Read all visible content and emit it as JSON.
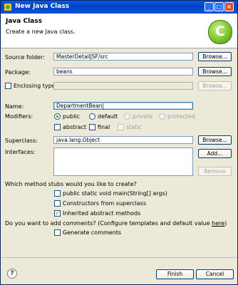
{
  "window": {
    "title": "New Java Class",
    "title_buttons": [
      "_",
      "□",
      "×"
    ]
  },
  "banner": {
    "title": "Java Class",
    "message": "Create a new Java class.",
    "logo_letter": "C"
  },
  "source_folder": {
    "label": "Source folder:",
    "value": "MasterDetailJSF/src",
    "browse": "Browse..."
  },
  "package": {
    "label": "Package:",
    "value": "beans",
    "browse": "Browse..."
  },
  "enclosing": {
    "label": "Enclosing type:",
    "value": "",
    "browse": "Browse...",
    "checked": false
  },
  "name": {
    "label": "Name:",
    "value": "DepartmentBean|"
  },
  "modifiers": {
    "label": "Modifiers:",
    "radios": [
      {
        "label": "public",
        "selected": true,
        "enabled": true
      },
      {
        "label": "default",
        "selected": false,
        "enabled": true
      },
      {
        "label": "private",
        "selected": false,
        "enabled": false
      },
      {
        "label": "protected",
        "selected": false,
        "enabled": false
      }
    ],
    "checks": [
      {
        "label": "abstract",
        "checked": false,
        "enabled": true
      },
      {
        "label": "final",
        "checked": false,
        "enabled": true
      },
      {
        "label": "static",
        "checked": false,
        "enabled": false
      }
    ]
  },
  "superclass": {
    "label": "Superclass:",
    "value": "java.lang.Object",
    "browse": "Browse..."
  },
  "interfaces": {
    "label": "Interfaces:",
    "add": "Add...",
    "remove": "Remove"
  },
  "stubs": {
    "question": "Which method stubs would you like to create?",
    "options": [
      {
        "label": "public static void main(String[] args)",
        "checked": false
      },
      {
        "label": "Constructors from superclass",
        "checked": false
      },
      {
        "label": "Inherited abstract methods",
        "checked": true
      }
    ]
  },
  "comments": {
    "question_prefix": "Do you want to add comments? (Configure templates and default value ",
    "link": "here",
    "question_suffix": ")",
    "option": {
      "label": "Generate comments",
      "checked": false
    }
  },
  "footer": {
    "help": "?",
    "finish": "Finish",
    "cancel": "Cancel"
  }
}
